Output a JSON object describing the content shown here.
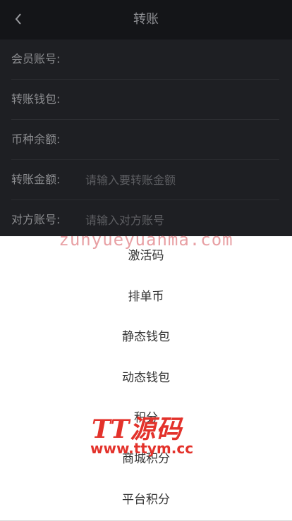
{
  "header": {
    "title": "转账",
    "back_icon": "chevron-left-icon"
  },
  "form": {
    "member_account": {
      "label": "会员账号:"
    },
    "transfer_wallet": {
      "label": "转账钱包:"
    },
    "currency_balance": {
      "label": "币种余额:"
    },
    "transfer_amount": {
      "label": "转账金额:",
      "placeholder": "请输入要转账金额"
    },
    "recipient_account": {
      "label": "对方账号:",
      "placeholder": "请输入对方账号"
    }
  },
  "picker": {
    "options": [
      {
        "label": "激活码"
      },
      {
        "label": "排单币"
      },
      {
        "label": "静态钱包"
      },
      {
        "label": "动态钱包"
      },
      {
        "label": "积分"
      },
      {
        "label": "商城积分"
      },
      {
        "label": "平台积分"
      }
    ]
  },
  "watermark": {
    "url_text": "zunyueyuanma.com",
    "brand_text": "TT源码",
    "site_text": "www.ttym.cc"
  },
  "colors": {
    "page_bg": "#1e1f23",
    "header_bg": "#141518",
    "sheet_bg": "#ffffff",
    "watermark_red": "#e3322b"
  }
}
